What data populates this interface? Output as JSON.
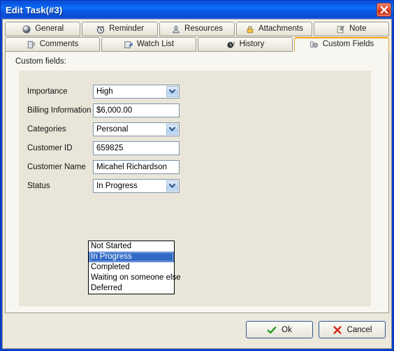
{
  "window": {
    "title": "Edit Task(#3)",
    "close_label": "Close",
    "close_icon": "close-x-icon",
    "accent_title_blue": "#0b5ae6",
    "frame_blue": "#0a42d4"
  },
  "tabs": {
    "active": "Custom Fields",
    "active_border_color": "#f2a816",
    "row1": [
      {
        "label": "General",
        "icon": "sphere-icon"
      },
      {
        "label": "Reminder",
        "icon": "alarm-clock-icon"
      },
      {
        "label": "Resources",
        "icon": "person-icon"
      },
      {
        "label": "Attachments",
        "icon": "lock-icon"
      },
      {
        "label": "Note",
        "icon": "pushpin-note-icon"
      }
    ],
    "row2": [
      {
        "label": "Comments",
        "icon": "comments-list-icon"
      },
      {
        "label": "Watch List",
        "icon": "watch-list-icon"
      },
      {
        "label": "History",
        "icon": "clock-history-icon"
      },
      {
        "label": "Custom Fields",
        "icon": "gear-fields-icon"
      }
    ]
  },
  "panel": {
    "heading": "Custom fields:",
    "background": "#e9e6d9",
    "fields": [
      {
        "label": "Importance",
        "type": "combo",
        "value": "High"
      },
      {
        "label": "Billing Information",
        "type": "text",
        "value": "$6,000.00"
      },
      {
        "label": "Categories",
        "type": "combo",
        "value": "Personal"
      },
      {
        "label": "Customer ID",
        "type": "text",
        "value": "659825"
      },
      {
        "label": "Customer Name",
        "type": "text",
        "value": "Micahel Richardson"
      },
      {
        "label": "Status",
        "type": "combo",
        "value": "In Progress"
      }
    ]
  },
  "status_dropdown": {
    "open": true,
    "selected": "In Progress",
    "highlight_color": "#3169c6",
    "options": [
      "Not Started",
      "In Progress",
      "Completed",
      "Waiting on someone else",
      "Deferred"
    ]
  },
  "footer": {
    "ok_label": "Ok",
    "ok_icon": "green-check-icon",
    "ok_icon_color": "#1a9a1a",
    "cancel_label": "Cancel",
    "cancel_icon": "red-x-icon",
    "cancel_icon_color": "#d42a1e"
  }
}
